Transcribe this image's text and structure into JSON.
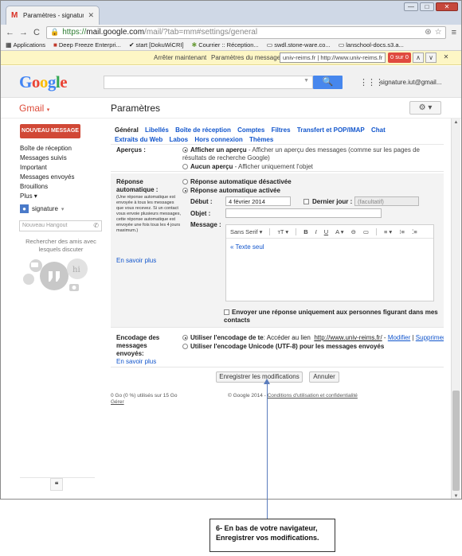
{
  "browser": {
    "tab_title": "Paramètres - signature.iut©",
    "tab_close": "✕",
    "window_controls": {
      "minimize": "—",
      "maximize": "□",
      "close": "✕"
    },
    "nav": {
      "back": "←",
      "forward": "→",
      "reload": "C"
    },
    "url": {
      "scheme": "https://",
      "host": "mail.google.com",
      "path": "/mail/?tab=mm#settings/general"
    },
    "omnibox_icons": {
      "extension": "⊛",
      "star": "☆"
    },
    "menu": "≡"
  },
  "bookmarks": [
    {
      "icon": "▦",
      "label": "Applications"
    },
    {
      "icon": "■",
      "label": "Deep Freeze Enterpri..."
    },
    {
      "icon": "✔",
      "label": "start [DokuWiCRI]"
    },
    {
      "icon": "✱",
      "label": "Courrier :: Réception..."
    },
    {
      "icon": "▭",
      "label": "swdl.stone-ware.co..."
    },
    {
      "icon": "▭",
      "label": "lanschool-docs.s3.a..."
    }
  ],
  "extension_bar": {
    "stop": "Arrêter maintenant",
    "params": "Paramètres du message",
    "url_box": "univ-reims.fr | http://www.univ-reims.fr",
    "count": "0 sur 0",
    "prev": "∧",
    "next": "∨",
    "close": "✕"
  },
  "google": {
    "logo_letters": [
      "G",
      "o",
      "o",
      "g",
      "l",
      "e"
    ],
    "logo_colors": [
      "#4285f4",
      "#ea4335",
      "#fbbc05",
      "#4285f4",
      "#34a853",
      "#ea4335"
    ],
    "search_placeholder": "",
    "search_dropdown": "▼",
    "search_button": "🔍",
    "apps_icon": "⋮⋮⋮",
    "account": "signature.iut@gmail..."
  },
  "gmail": {
    "label": "Gmail",
    "caret": "▾",
    "page_title": "Paramètres",
    "gear": "⚙ ▾"
  },
  "sidebar": {
    "compose": "NOUVEAU MESSAGE",
    "items": [
      "Boîte de réception",
      "Messages suivis",
      "Important",
      "Messages envoyés",
      "Brouillons",
      "Plus ▾"
    ],
    "hangout_user": "signature",
    "hangout_user_caret": "▾",
    "hangout_avatar": "●",
    "hangout_placeholder": "Nouveau Hangout",
    "hangout_phone": "✆",
    "hangout_text": "Rechercher des amis avec lesquels discuter",
    "hangout_art_label": "hi",
    "bottom_icon": "❝"
  },
  "tabs": [
    "Général",
    "Libellés",
    "Boîte de réception",
    "Comptes",
    "Filtres",
    "Transfert et POP/IMAP",
    "Chat",
    "Extraits du Web",
    "Labos",
    "Hors connexion",
    "Thèmes"
  ],
  "settings": {
    "apercu": {
      "label": "Aperçus :",
      "opt1_bold": "Afficher un aperçu",
      "opt1_desc": " - Afficher un aperçu des messages (comme sur les pages de résultats de recherche Google)",
      "opt2_bold": "Aucun aperçu",
      "opt2_desc": " - Afficher uniquement l'objet"
    },
    "reponse": {
      "label": "Réponse automatique :",
      "help": "(Une réponse automatique est envoyée à tous les messages que vous recevez. Si un contact vous envoie plusieurs messages, cette réponse automatique est envoyée une fois tous les 4 jours maximum.)",
      "help_link": "En savoir plus",
      "off": "Réponse automatique désactivée",
      "on": "Réponse automatique activée",
      "debut_label": "Début :",
      "debut_value": "4 février 2014",
      "dernier_label": "Dernier jour :",
      "dernier_value": "(facultatif)",
      "objet_label": "Objet :",
      "objet_value": "",
      "message_label": "Message :",
      "toolbar": {
        "font": "Sans Serif ▾",
        "size": "ᴛT ▾",
        "bold": "B",
        "italic": "I",
        "underline": "U",
        "color": "A ▾",
        "link": "⊖",
        "image": "▭",
        "align": "≡ ▾",
        "numbered": "⁝≡",
        "bulleted": "⁚≡"
      },
      "editor_link": "« Texte seul",
      "contacts_only": "Envoyer une réponse uniquement aux personnes figurant dans mes contacts"
    },
    "encodage": {
      "label": "Encodage des messages envoyés:",
      "link": "En savoir plus",
      "opt1_bold": "Utiliser l'encodage de te",
      "opt1_rest": "Accéder au lien",
      "opt1_url": "http://www.univ-reims.fr/",
      "opt1_modify": "Modifier",
      "opt1_delete": "Supprimer",
      "opt2_bold": "Utiliser l'encodage Unicode (UTF-8) pour les messages envoyés"
    }
  },
  "buttons": {
    "save": "Enregistrer les modifications",
    "cancel": "Annuler"
  },
  "footer": {
    "quota": "0 Go (0 %) utilisés sur 15 Go",
    "manage": "Gérer",
    "copyright": "© Google 2014 - ",
    "terms": "Conditions d'utilisation et confidentialité"
  },
  "scrollbar": {
    "up": "▲",
    "down": "▼"
  },
  "annotation": {
    "line1": "6- En bas de votre navigateur,",
    "line2": "Enregistrer vos modifications."
  }
}
